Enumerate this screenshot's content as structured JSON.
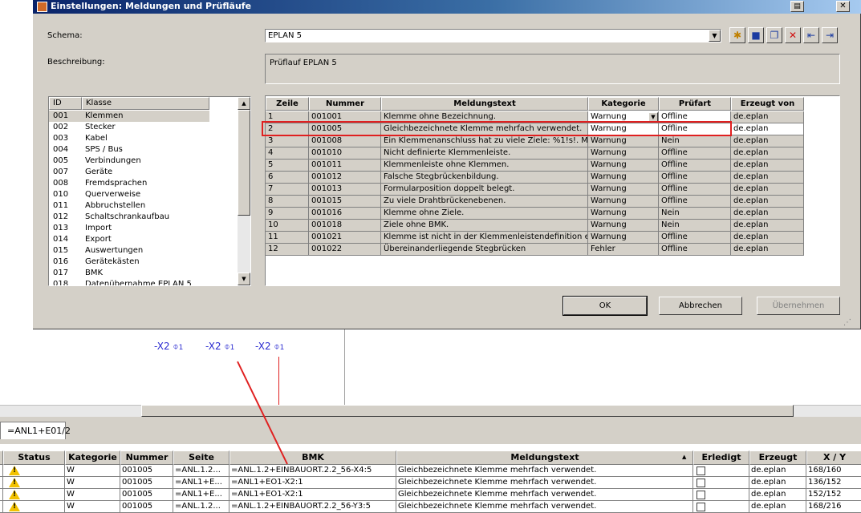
{
  "dialog": {
    "title": "Einstellungen: Meldungen und Prüfläufe",
    "schema_label": "Schema:",
    "schema_value": "EPLAN 5",
    "description_label": "Beschreibung:",
    "description_value": "Prüflauf EPLAN 5",
    "toolbar_icons": [
      "new-icon",
      "save-icon",
      "copy-icon",
      "delete-icon",
      "import-icon",
      "export-icon"
    ],
    "class_list": {
      "headers": [
        "ID",
        "Klasse"
      ],
      "rows": [
        [
          "001",
          "Klemmen"
        ],
        [
          "002",
          "Stecker"
        ],
        [
          "003",
          "Kabel"
        ],
        [
          "004",
          "SPS / Bus"
        ],
        [
          "005",
          "Verbindungen"
        ],
        [
          "007",
          "Geräte"
        ],
        [
          "008",
          "Fremdsprachen"
        ],
        [
          "010",
          "Querverweise"
        ],
        [
          "011",
          "Abbruchstellen"
        ],
        [
          "012",
          "Schaltschrankaufbau"
        ],
        [
          "013",
          "Import"
        ],
        [
          "014",
          "Export"
        ],
        [
          "015",
          "Auswertungen"
        ],
        [
          "016",
          "Gerätekästen"
        ],
        [
          "017",
          "BMK"
        ],
        [
          "018",
          "Datenübernahme EPLAN 5"
        ]
      ]
    },
    "grid": {
      "headers": [
        "Zeile",
        "Nummer",
        "Meldungstext",
        "Kategorie",
        "Prüfart",
        "Erzeugt von"
      ],
      "rows": [
        [
          "1",
          "001001",
          "Klemme ohne Bezeichnung.",
          "Warnung",
          "Offline",
          "de.eplan"
        ],
        [
          "2",
          "001005",
          "Gleichbezeichnete Klemme mehrfach verwendet.",
          "Warnung",
          "Offline",
          "de.eplan"
        ],
        [
          "3",
          "001008",
          "Ein Klemmenanschluss hat zu viele Ziele: %1!s!. M...",
          "Warnung",
          "Nein",
          "de.eplan"
        ],
        [
          "4",
          "001010",
          "Nicht definierte Klemmenleiste.",
          "Warnung",
          "Offline",
          "de.eplan"
        ],
        [
          "5",
          "001011",
          "Klemmenleiste ohne Klemmen.",
          "Warnung",
          "Offline",
          "de.eplan"
        ],
        [
          "6",
          "001012",
          "Falsche Stegbrückenbildung.",
          "Warnung",
          "Offline",
          "de.eplan"
        ],
        [
          "7",
          "001013",
          "Formularposition doppelt belegt.",
          "Warnung",
          "Offline",
          "de.eplan"
        ],
        [
          "8",
          "001015",
          "Zu viele Drahtbrückenebenen.",
          "Warnung",
          "Offline",
          "de.eplan"
        ],
        [
          "9",
          "001016",
          "Klemme ohne Ziele.",
          "Warnung",
          "Nein",
          "de.eplan"
        ],
        [
          "10",
          "001018",
          "Ziele ohne BMK.",
          "Warnung",
          "Nein",
          "de.eplan"
        ],
        [
          "11",
          "001021",
          "Klemme ist nicht in der Klemmenleistendefinition en...",
          "Warnung",
          "Offline",
          "de.eplan"
        ],
        [
          "12",
          "001022",
          "Übereinanderliegende Stegbrücken",
          "Fehler",
          "Offline",
          "de.eplan"
        ]
      ]
    },
    "buttons": {
      "ok": "OK",
      "cancel": "Abbrechen",
      "apply": "Übernehmen"
    }
  },
  "schematic": {
    "symbols": [
      "-X2",
      "-X2",
      "-X2"
    ],
    "pin": "1",
    "page_tab": "=ANL1+E01/2"
  },
  "messages": {
    "headers": [
      "Status",
      "Kategorie",
      "Nummer",
      "Seite",
      "BMK",
      "Meldungstext",
      "Erledigt",
      "Erzeugt",
      "X / Y"
    ],
    "rows": [
      [
        "W",
        "001005",
        "=ANL.1.2...",
        "=ANL.1.2+EINBAUORT.2.2_56-X4:5",
        "Gleichbezeichnete Klemme mehrfach verwendet.",
        "de.eplan",
        "168/160"
      ],
      [
        "W",
        "001005",
        "=ANL1+E...",
        "=ANL1+EO1-X2:1",
        "Gleichbezeichnete Klemme mehrfach verwendet.",
        "de.eplan",
        "136/152"
      ],
      [
        "W",
        "001005",
        "=ANL1+E...",
        "=ANL1+EO1-X2:1",
        "Gleichbezeichnete Klemme mehrfach verwendet.",
        "de.eplan",
        "152/152"
      ],
      [
        "W",
        "001005",
        "=ANL.1.2...",
        "=ANL.1.2+EINBAUORT.2.2_56-Y3:5",
        "Gleichbezeichnete Klemme mehrfach verwendet.",
        "de.eplan",
        "168/216"
      ]
    ]
  },
  "colors": {
    "annotation": "#e02020",
    "symbol": "#2a2ad0",
    "warning": "#f2c200"
  }
}
